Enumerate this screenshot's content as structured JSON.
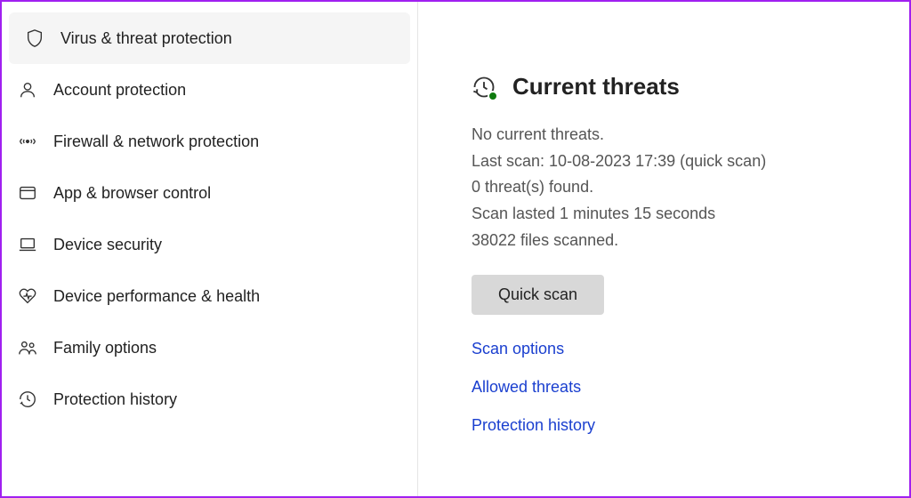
{
  "sidebar": {
    "items": [
      {
        "label": "Virus & threat protection",
        "selected": true
      },
      {
        "label": "Account protection",
        "selected": false
      },
      {
        "label": "Firewall & network protection",
        "selected": false
      },
      {
        "label": "App & browser control",
        "selected": false
      },
      {
        "label": "Device security",
        "selected": false
      },
      {
        "label": "Device performance & health",
        "selected": false
      },
      {
        "label": "Family options",
        "selected": false
      },
      {
        "label": "Protection history",
        "selected": false
      }
    ]
  },
  "main": {
    "section_title": "Current threats",
    "no_threats": "No current threats.",
    "last_scan": "Last scan: 10-08-2023 17:39 (quick scan)",
    "threats_found": "0 threat(s) found.",
    "scan_duration": "Scan lasted 1 minutes 15 seconds",
    "files_scanned": "38022 files scanned.",
    "quick_scan_button": "Quick scan",
    "links": {
      "scan_options": "Scan options",
      "allowed_threats": "Allowed threats",
      "protection_history": "Protection history"
    }
  },
  "colors": {
    "accent": "#a020f0",
    "link": "#1a3fcf",
    "success": "#0f7b0f"
  }
}
